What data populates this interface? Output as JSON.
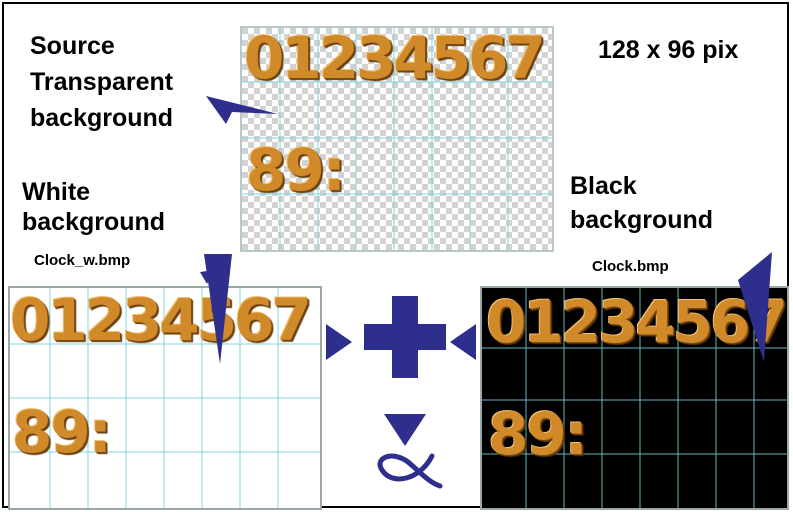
{
  "labels": {
    "source_line1": "Source",
    "source_line2": "Transparent",
    "source_line3": "background",
    "size": "128 x 96 pix",
    "white_line1": "White",
    "white_line2": "background",
    "white_file": "Clock_w.bmp",
    "black_line1": "Black",
    "black_line2": "background",
    "black_file": "Clock.bmp"
  },
  "digits": {
    "row1": "01234567",
    "row2": "89:"
  },
  "colors": {
    "arrow": "#2e2e8c",
    "digit": "#d08a2a",
    "grid": "#7fd6dc",
    "black_bg": "#000000"
  },
  "symbols": {
    "plus": "plus-sign",
    "result": "fish-symbol"
  }
}
